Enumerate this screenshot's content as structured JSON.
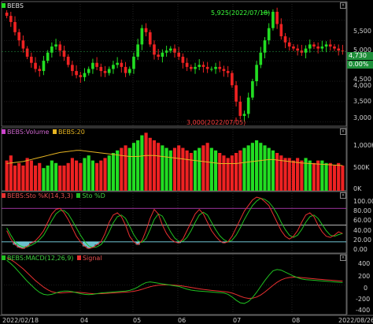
{
  "panes": {
    "price": {
      "title": "BEBS",
      "high_callout": "5,925(2022/07/18)",
      "low_callout": "3,000(2022/07/05)",
      "last_price": "4,730",
      "last_change_pct": "0.00%",
      "y_ticks": [
        "5,500",
        "5,000",
        "4,500",
        "4,000",
        "3,500",
        "3,000"
      ]
    },
    "volume": {
      "title": "BEBS:Volume",
      "ma_label": "BEBS:20",
      "y_ticks": [
        "1,000K",
        "500K",
        "0K"
      ]
    },
    "stoch": {
      "title": "BEBS:Sto %K(14,3,3)",
      "d_label": "Sto %D",
      "y_ticks": [
        "100.00",
        "80.00",
        "60.00",
        "40.00",
        "20.00",
        "0.00"
      ]
    },
    "macd": {
      "title": "BEBS:MACD(12,26,9)",
      "signal_label": "Signal",
      "y_ticks": [
        "400",
        "200",
        "0",
        "-200",
        "-400"
      ]
    }
  },
  "x_axis": {
    "ticks": [
      "2022/02/18",
      "04",
      "05",
      "06",
      "07",
      "08",
      "2022/08/26"
    ]
  },
  "colors": {
    "background": "#000000",
    "up": "#22dd22",
    "down": "#ee2222",
    "volume_ma": "#e6b422",
    "stoch_k": "#e83030",
    "stoch_d": "#20c020",
    "macd": "#20c020",
    "signal": "#e83030",
    "overbought": "#cc44cc",
    "stoch_fill": "#7fe0f0",
    "grid": "#3a3a3a",
    "separator": "#888888"
  },
  "chart_data": [
    {
      "type": "candlestick",
      "title": "BEBS",
      "ylim": [
        2900,
        5950
      ],
      "x_start": "2022/02/18",
      "x_end": "2022/08/26",
      "series": [
        {
          "values": [
            5600,
            5450,
            5200,
            5000,
            4800,
            4600,
            4450,
            4300,
            4250,
            4500,
            4700,
            4850,
            4900,
            4750,
            4600,
            4400,
            4250,
            4150,
            4100,
            4200,
            4300,
            4450,
            4350,
            4250,
            4200,
            4300,
            4400,
            4450,
            4350,
            4200,
            4300,
            4600,
            4900,
            5300,
            5200,
            4900,
            4650,
            4600,
            4700,
            4750,
            4800,
            4700,
            4600,
            4450,
            4350,
            4300,
            4350,
            4400,
            4350,
            4300,
            4300,
            4350,
            4300,
            4250,
            4200,
            3900,
            3500,
            3150,
            3200,
            3600,
            4000,
            4400,
            4700,
            5000,
            5300,
            5700,
            5400,
            5100,
            4950,
            4850,
            4800,
            4750,
            4700,
            4800,
            4900,
            4850,
            4800,
            4850,
            4900,
            4850,
            4800,
            4750,
            4730
          ]
        }
      ]
    },
    {
      "type": "bar",
      "title": "BEBS:Volume",
      "ylim": [
        0,
        1250000
      ],
      "series": [
        {
          "name": "BEBS:Volume",
          "values": [
            600000,
            700000,
            500000,
            550000,
            500000,
            650000,
            600000,
            500000,
            550000,
            450000,
            500000,
            600000,
            550000,
            500000,
            500000,
            550000,
            650000,
            600000,
            550000,
            650000,
            700000,
            600000,
            550000,
            600000,
            650000,
            700000,
            750000,
            800000,
            850000,
            900000,
            850000,
            950000,
            1000000,
            1100000,
            1150000,
            1050000,
            1000000,
            950000,
            900000,
            850000,
            800000,
            850000,
            900000,
            850000,
            800000,
            750000,
            800000,
            850000,
            900000,
            950000,
            850000,
            800000,
            750000,
            700000,
            650000,
            700000,
            750000,
            800000,
            850000,
            900000,
            950000,
            1000000,
            950000,
            900000,
            850000,
            800000,
            750000,
            700000,
            650000,
            650000,
            600000,
            650000,
            600000,
            650000,
            600000,
            550000,
            600000,
            600000,
            550000,
            550000,
            500000,
            550000,
            500000
          ]
        },
        {
          "name": "BEBS:20",
          "values": [
            540000,
            550000,
            560000,
            570000,
            580000,
            600000,
            620000,
            640000,
            660000,
            680000,
            700000,
            720000,
            740000,
            760000,
            770000,
            780000,
            790000,
            800000,
            800000,
            790000,
            780000,
            770000,
            760000,
            750000,
            740000,
            730000,
            720000,
            710000,
            700000,
            690000,
            680000,
            680000,
            680000,
            690000,
            700000,
            700000,
            700000,
            690000,
            680000,
            670000,
            660000,
            650000,
            640000,
            630000,
            620000,
            610000,
            600000,
            590000,
            580000,
            570000,
            560000,
            550000,
            540000,
            540000,
            540000,
            540000,
            540000,
            550000,
            560000,
            570000,
            580000,
            590000,
            600000,
            610000,
            620000,
            620000,
            610000,
            600000,
            590000,
            580000,
            570000,
            560000,
            550000,
            545000,
            540000,
            535000,
            530000,
            525000,
            520000,
            515000,
            510000,
            505000,
            500000
          ]
        }
      ]
    },
    {
      "type": "line",
      "title": "BEBS:Sto %K(14,3,3)",
      "ylim": [
        0,
        110
      ],
      "reference_lines": [
        80,
        50,
        20
      ],
      "series": [
        {
          "name": "BEBS:Sto %K(14,3,3)",
          "values": [
            40,
            25,
            15,
            10,
            8,
            12,
            18,
            22,
            30,
            40,
            55,
            70,
            78,
            80,
            72,
            60,
            45,
            30,
            20,
            12,
            8,
            10,
            15,
            20,
            35,
            55,
            68,
            72,
            65,
            50,
            30,
            20,
            15,
            22,
            40,
            62,
            78,
            70,
            50,
            35,
            25,
            20,
            18,
            25,
            40,
            55,
            70,
            78,
            70,
            55,
            40,
            30,
            22,
            18,
            20,
            30,
            45,
            60,
            75,
            85,
            95,
            100,
            98,
            92,
            85,
            70,
            55,
            40,
            30,
            25,
            30,
            40,
            55,
            68,
            72,
            65,
            50,
            38,
            30,
            28,
            32,
            38,
            35
          ]
        },
        {
          "name": "Sto %D",
          "values": [
            45,
            32,
            20,
            14,
            11,
            11,
            14,
            18,
            24,
            32,
            45,
            58,
            70,
            76,
            76,
            70,
            58,
            45,
            32,
            21,
            13,
            10,
            11,
            15,
            24,
            38,
            54,
            65,
            68,
            62,
            48,
            33,
            22,
            19,
            26,
            42,
            60,
            70,
            66,
            52,
            38,
            27,
            21,
            21,
            28,
            40,
            55,
            68,
            73,
            68,
            55,
            42,
            31,
            24,
            20,
            23,
            32,
            45,
            60,
            73,
            85,
            93,
            98,
            96,
            91,
            82,
            70,
            55,
            42,
            32,
            28,
            32,
            42,
            55,
            65,
            68,
            62,
            51,
            40,
            32,
            30,
            33,
            35
          ]
        }
      ]
    },
    {
      "type": "line",
      "title": "BEBS:MACD(12,26,9)",
      "ylim": [
        -450,
        480
      ],
      "series": [
        {
          "name": "BEBS:MACD(12,26,9)",
          "values": [
            380,
            330,
            270,
            200,
            130,
            60,
            0,
            -60,
            -110,
            -140,
            -150,
            -140,
            -120,
            -100,
            -90,
            -90,
            -100,
            -115,
            -130,
            -140,
            -145,
            -140,
            -130,
            -120,
            -115,
            -110,
            -105,
            -100,
            -95,
            -90,
            -80,
            -60,
            -30,
            10,
            40,
            50,
            40,
            30,
            20,
            10,
            0,
            -10,
            -20,
            -40,
            -60,
            -75,
            -85,
            -90,
            -95,
            -100,
            -105,
            -110,
            -115,
            -120,
            -140,
            -180,
            -230,
            -270,
            -280,
            -250,
            -190,
            -110,
            -20,
            70,
            150,
            220,
            240,
            230,
            200,
            170,
            140,
            115,
            95,
            85,
            80,
            75,
            70,
            65,
            60,
            55,
            50,
            45,
            40
          ]
        },
        {
          "name": "Signal",
          "values": [
            420,
            390,
            350,
            300,
            250,
            190,
            130,
            70,
            20,
            -30,
            -70,
            -100,
            -115,
            -120,
            -115,
            -110,
            -108,
            -108,
            -112,
            -118,
            -125,
            -130,
            -132,
            -130,
            -127,
            -123,
            -119,
            -115,
            -111,
            -107,
            -102,
            -94,
            -82,
            -64,
            -43,
            -24,
            -10,
            0,
            5,
            6,
            4,
            0,
            -5,
            -14,
            -24,
            -35,
            -46,
            -56,
            -65,
            -73,
            -80,
            -86,
            -92,
            -98,
            -106,
            -121,
            -143,
            -169,
            -191,
            -203,
            -200,
            -182,
            -150,
            -106,
            -55,
            -3,
            44,
            81,
            105,
            118,
            123,
            121,
            116,
            110,
            104,
            98,
            92,
            87,
            82,
            77,
            72,
            67,
            62
          ]
        }
      ]
    }
  ]
}
